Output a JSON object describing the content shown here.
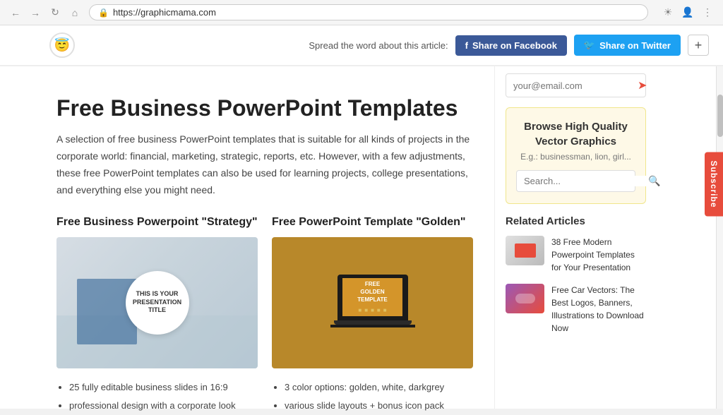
{
  "browser": {
    "url": "https://graphicmama.com",
    "nav_back": "←",
    "nav_forward": "→",
    "nav_refresh": "↺",
    "nav_home": "⌂"
  },
  "header": {
    "logo_icon": "😊",
    "share_prompt": "Spread the word about this article:",
    "share_facebook_label": "Share on Facebook",
    "share_twitter_label": "Share on Twitter",
    "plus_label": "+"
  },
  "article": {
    "title": "Free Business PowerPoint Templates",
    "intro": "A selection of free business PowerPoint templates that is suitable for all kinds of projects in the corporate world: financial, marketing, strategic, reports, etc. However, with a few adjustments, these free PowerPoint templates can also be used for learning projects, college presentations, and everything else you might need.",
    "section1_title": "Free Business Powerpoint \"Strategy\"",
    "section2_title": "Free PowerPoint Template \"Golden\"",
    "strategy_badge_line1": "THIS IS YOUR",
    "strategy_badge_line2": "PRESENTATION",
    "strategy_badge_line3": "TITLE",
    "golden_screen_line1": "FREE",
    "golden_screen_line2": "GOLDEN",
    "golden_screen_line3": "TEMPLATE",
    "bullet1_1": "25 fully editable business slides in 16:9",
    "bullet1_2": "professional design with a corporate look",
    "bullet2_1": "3 color options: golden, white, darkgrey",
    "bullet2_2": "various slide layouts + bonus icon pack"
  },
  "sidebar": {
    "email_placeholder": "your@email.com",
    "browse_title": "Browse High Quality Vector Graphics",
    "browse_subtitle": "E.g.: businessman, lion, girl...",
    "search_placeholder": "Search...",
    "related_title": "Related Articles",
    "article1_title": "38 Free Modern Powerpoint Templates for Your Presentation",
    "article2_title": "Free Car Vectors: The Best Logos, Banners, Illustrations to Download Now"
  },
  "subscribe": {
    "label": "Subscribe"
  }
}
